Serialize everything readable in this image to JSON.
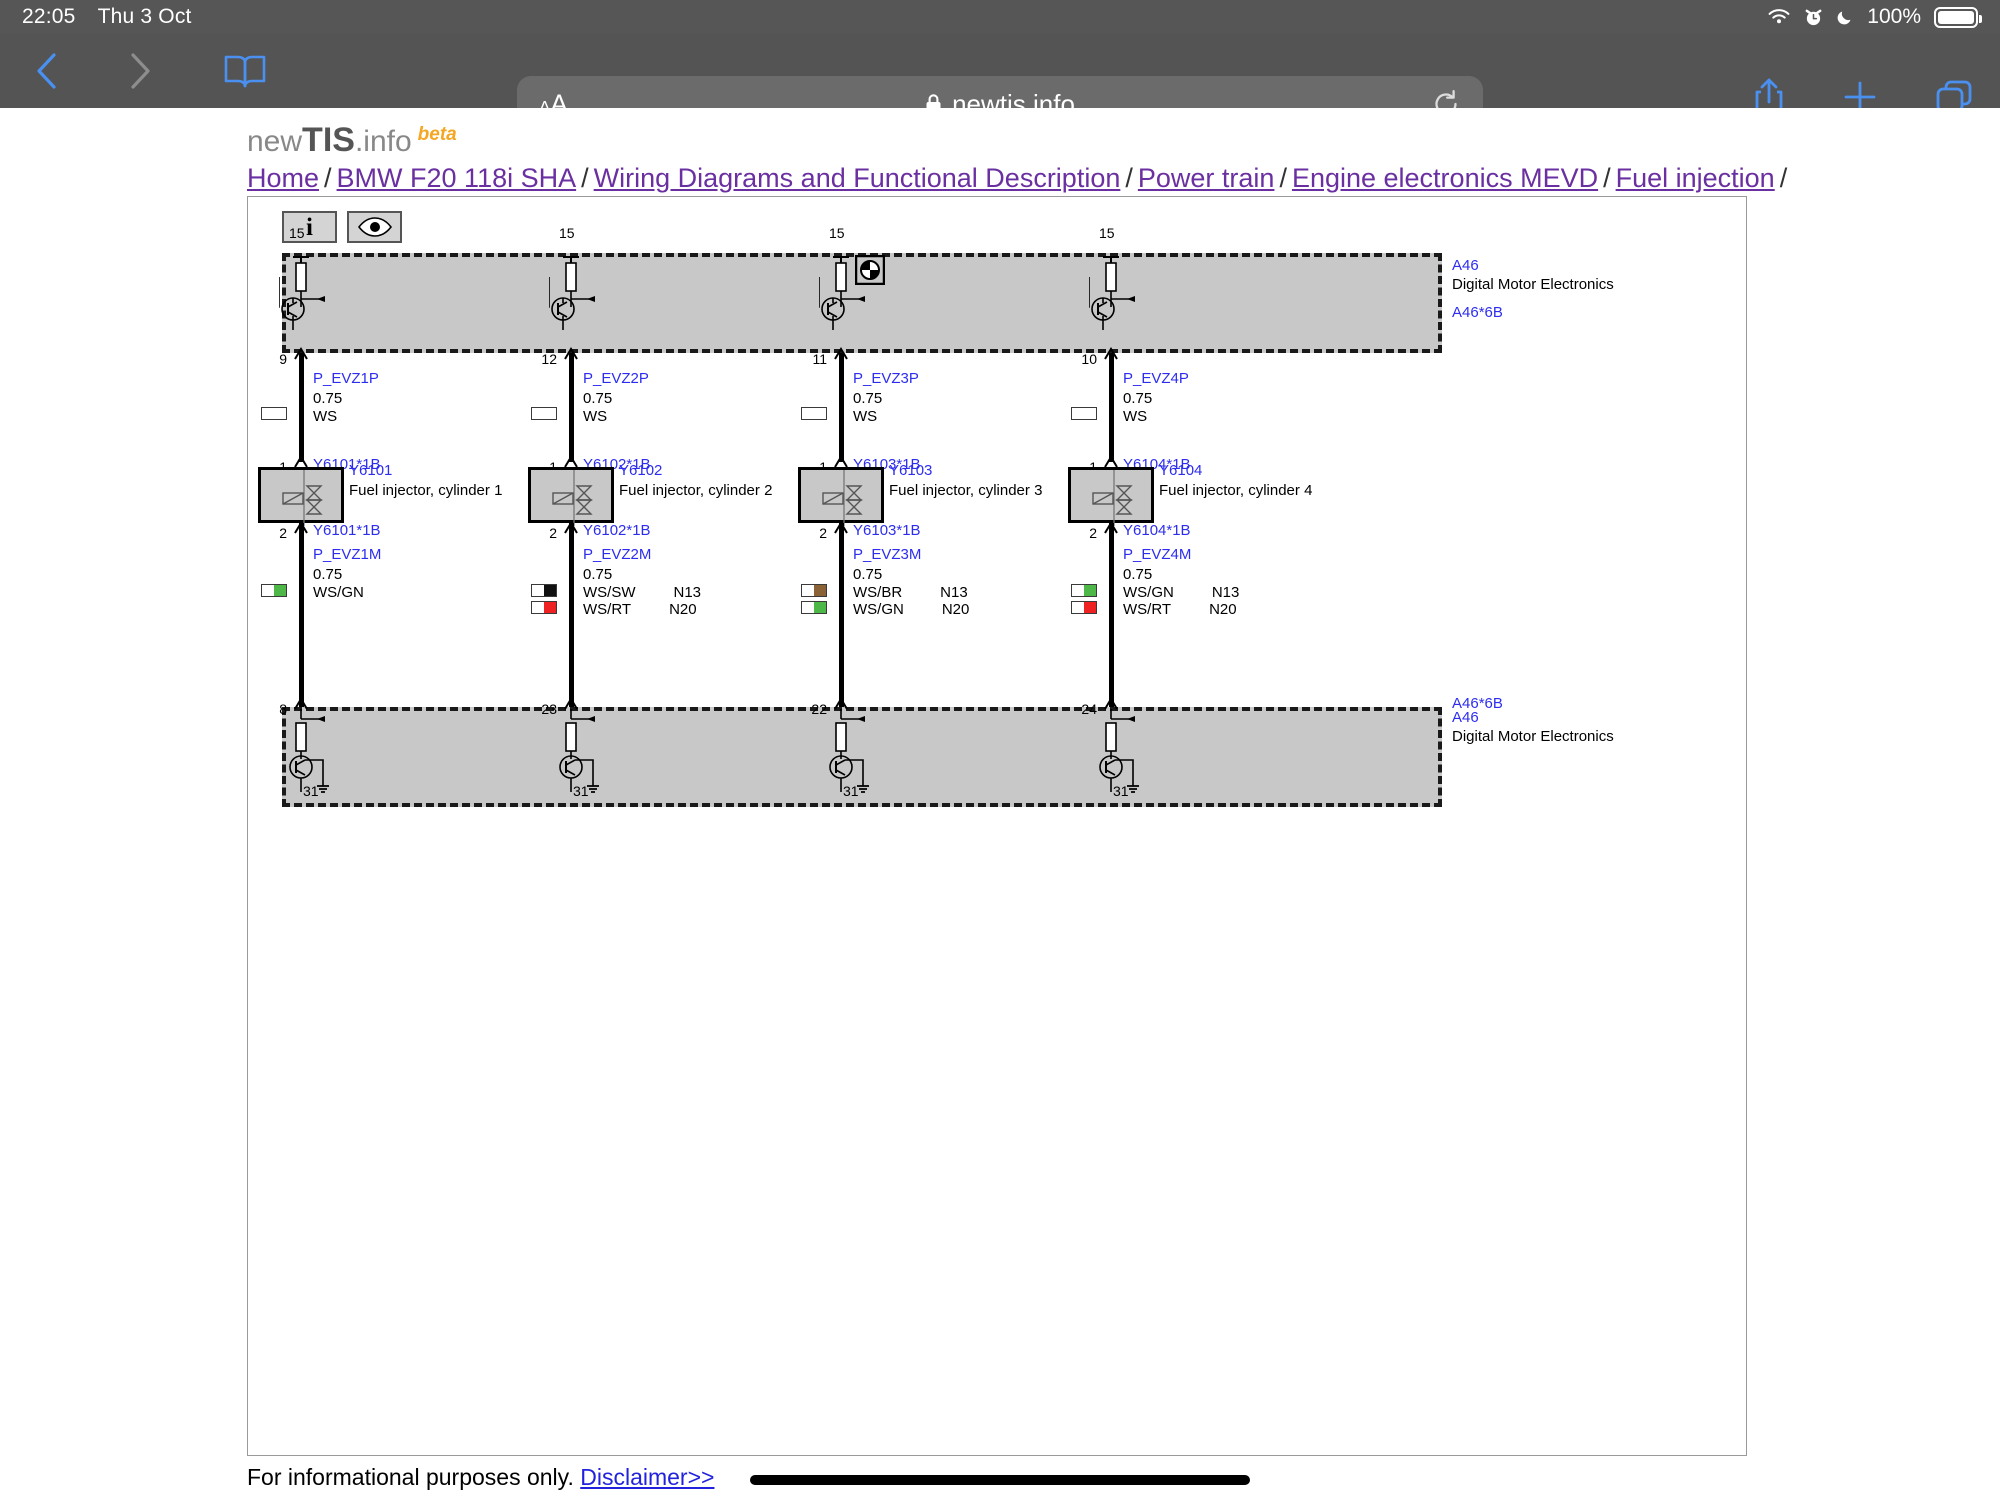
{
  "status_bar": {
    "time": "22:05",
    "date": "Thu 3 Oct",
    "battery_percent": "100%",
    "icons": [
      "wifi-icon",
      "alarm-icon",
      "moon-icon",
      "battery-icon"
    ]
  },
  "browser": {
    "back_label": "back-icon",
    "forward_label": "forward-icon",
    "bookmarks_label": "book-icon",
    "text_size_small": "A",
    "text_size_large": "A",
    "lock": "lock-icon",
    "url": "newtis.info",
    "reload_label": "reload-icon",
    "share_label": "share-icon",
    "new_tab_label": "plus-icon",
    "tabs_label": "tabs-icon"
  },
  "site": {
    "logo_prefix": "new",
    "logo_bold": "TIS",
    "logo_suffix": ".info",
    "logo_beta": "beta"
  },
  "breadcrumb": [
    "Home",
    "BMW F20 118i SHA",
    "Wiring Diagrams and Functional Description",
    "Power train",
    "Engine electronics MEVD",
    "Fuel injection"
  ],
  "toolbar": {
    "info_label": "i",
    "eye_label": "eye-icon"
  },
  "diagram": {
    "ecu_top": {
      "code": "A46",
      "desc": "Digital Motor Electronics",
      "connector": "A46*6B",
      "terminal": "15"
    },
    "ecu_bottom": {
      "code": "A46",
      "desc": "Digital Motor Electronics",
      "connector": "A46*6B",
      "ground": "31"
    },
    "columns": [
      {
        "top_pin": "9",
        "top_wire_name": "P_EVZ1P",
        "top_wire_size": "0.75",
        "top_wire_colors": [
          {
            "code": "WS",
            "swatch": "#ffffff",
            "note": ""
          }
        ],
        "conn_top": "Y6101*1B",
        "conn_top_pin": "1",
        "device_code": "Y6101",
        "device_desc": "Fuel injector, cylinder 1",
        "conn_bottom": "Y6101*1B",
        "conn_bottom_pin": "2",
        "bot_wire_name": "P_EVZ1M",
        "bot_wire_size": "0.75",
        "bot_wire_colors": [
          {
            "code": "WS/GN",
            "swatch": "#4db848",
            "note": ""
          }
        ],
        "bottom_pin": "8"
      },
      {
        "top_pin": "12",
        "top_wire_name": "P_EVZ2P",
        "top_wire_size": "0.75",
        "top_wire_colors": [
          {
            "code": "WS",
            "swatch": "#ffffff",
            "note": ""
          }
        ],
        "conn_top": "Y6102*1B",
        "conn_top_pin": "1",
        "device_code": "Y6102",
        "device_desc": "Fuel injector, cylinder 2",
        "conn_bottom": "Y6102*1B",
        "conn_bottom_pin": "2",
        "bot_wire_name": "P_EVZ2M",
        "bot_wire_size": "0.75",
        "bot_wire_colors": [
          {
            "code": "WS/SW",
            "swatch": "#111111",
            "note": "N13"
          },
          {
            "code": "WS/RT",
            "swatch": "#ee2222",
            "note": "N20"
          }
        ],
        "bottom_pin": "23"
      },
      {
        "top_pin": "11",
        "top_wire_name": "P_EVZ3P",
        "top_wire_size": "0.75",
        "top_wire_colors": [
          {
            "code": "WS",
            "swatch": "#ffffff",
            "note": ""
          }
        ],
        "conn_top": "Y6103*1B",
        "conn_top_pin": "1",
        "device_code": "Y6103",
        "device_desc": "Fuel injector, cylinder 3",
        "conn_bottom": "Y6103*1B",
        "conn_bottom_pin": "2",
        "bot_wire_name": "P_EVZ3M",
        "bot_wire_size": "0.75",
        "bot_wire_colors": [
          {
            "code": "WS/BR",
            "swatch": "#8a6236",
            "note": "N13"
          },
          {
            "code": "WS/GN",
            "swatch": "#4db848",
            "note": "N20"
          }
        ],
        "bottom_pin": "22"
      },
      {
        "top_pin": "10",
        "top_wire_name": "P_EVZ4P",
        "top_wire_size": "0.75",
        "top_wire_colors": [
          {
            "code": "WS",
            "swatch": "#ffffff",
            "note": ""
          }
        ],
        "conn_top": "Y6104*1B",
        "conn_top_pin": "1",
        "device_code": "Y6104",
        "device_desc": "Fuel injector, cylinder 4",
        "conn_bottom": "Y6104*1B",
        "conn_bottom_pin": "2",
        "bot_wire_name": "P_EVZ4M",
        "bot_wire_size": "0.75",
        "bot_wire_colors": [
          {
            "code": "WS/GN",
            "swatch": "#4db848",
            "note": "N13"
          },
          {
            "code": "WS/RT",
            "swatch": "#ee2222",
            "note": "N20"
          }
        ],
        "bottom_pin": "24"
      }
    ]
  },
  "footer": {
    "note": "For informational purposes only.",
    "disclaimer": "Disclaimer>>"
  }
}
